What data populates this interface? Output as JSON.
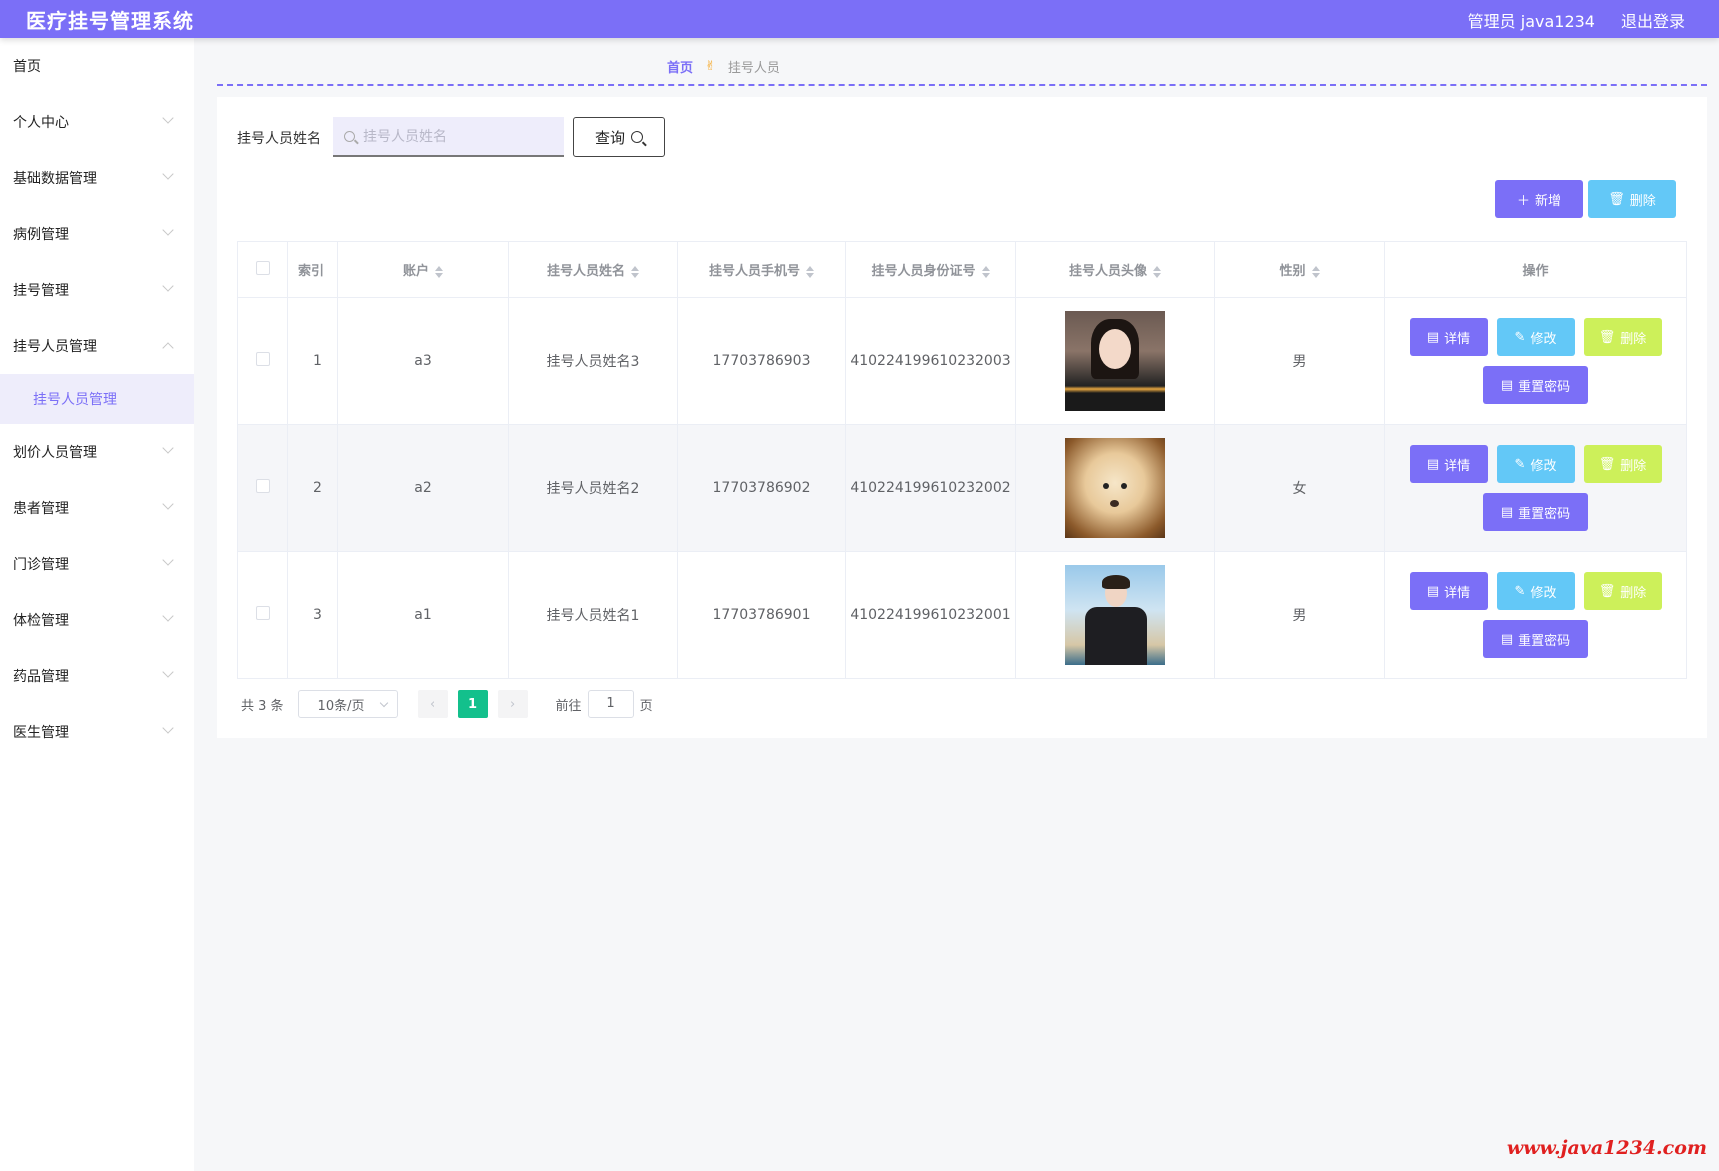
{
  "header": {
    "app_title": "医疗挂号管理系统",
    "user": "管理员 java1234",
    "logout": "退出登录"
  },
  "sidebar": {
    "items": [
      {
        "label": "首页",
        "chevron": false
      },
      {
        "label": "个人中心",
        "chevron": true
      },
      {
        "label": "基础数据管理",
        "chevron": true
      },
      {
        "label": "病例管理",
        "chevron": true
      },
      {
        "label": "挂号管理",
        "chevron": true
      },
      {
        "label": "挂号人员管理",
        "chevron": true,
        "expanded": true
      },
      {
        "label": "挂号人员管理",
        "sub": true,
        "active": true
      },
      {
        "label": "划价人员管理",
        "chevron": true
      },
      {
        "label": "患者管理",
        "chevron": true
      },
      {
        "label": "门诊管理",
        "chevron": true
      },
      {
        "label": "体检管理",
        "chevron": true
      },
      {
        "label": "药品管理",
        "chevron": true
      },
      {
        "label": "医生管理",
        "chevron": true
      }
    ]
  },
  "breadcrumb": {
    "home": "首页",
    "separator_icon": "hand-icon",
    "current": "挂号人员"
  },
  "search": {
    "label": "挂号人员姓名",
    "placeholder": "挂号人员姓名",
    "query_button": "查询"
  },
  "actions": {
    "add_label": "新增",
    "delete_label": "删除"
  },
  "table": {
    "columns": [
      "索引",
      "账户",
      "挂号人员姓名",
      "挂号人员手机号",
      "挂号人员身份证号",
      "挂号人员头像",
      "性别",
      "操作"
    ],
    "rows": [
      {
        "index": "1",
        "account": "a3",
        "name": "挂号人员姓名3",
        "phone": "17703786903",
        "id_card": "410224199610232003",
        "avatar": "girl-photo",
        "gender": "男"
      },
      {
        "index": "2",
        "account": "a2",
        "name": "挂号人员姓名2",
        "phone": "17703786902",
        "id_card": "410224199610232002",
        "avatar": "puppy-photo",
        "gender": "女"
      },
      {
        "index": "3",
        "account": "a1",
        "name": "挂号人员姓名1",
        "phone": "17703786901",
        "id_card": "410224199610232001",
        "avatar": "boy-photo",
        "gender": "男"
      }
    ],
    "row_actions": {
      "detail": "详情",
      "edit": "修改",
      "delete": "删除",
      "reset_password": "重置密码"
    }
  },
  "pagination": {
    "total": "共 3 条",
    "page_size": "10条/页",
    "current_page": "1",
    "goto_label": "前往",
    "goto_value": "1",
    "page_suffix": "页"
  },
  "watermark": "www.java1234.com",
  "colors": {
    "primary": "#7b6ff7",
    "info": "#63c8f7",
    "warning_lime": "#cdf05a",
    "success": "#13c08c"
  }
}
